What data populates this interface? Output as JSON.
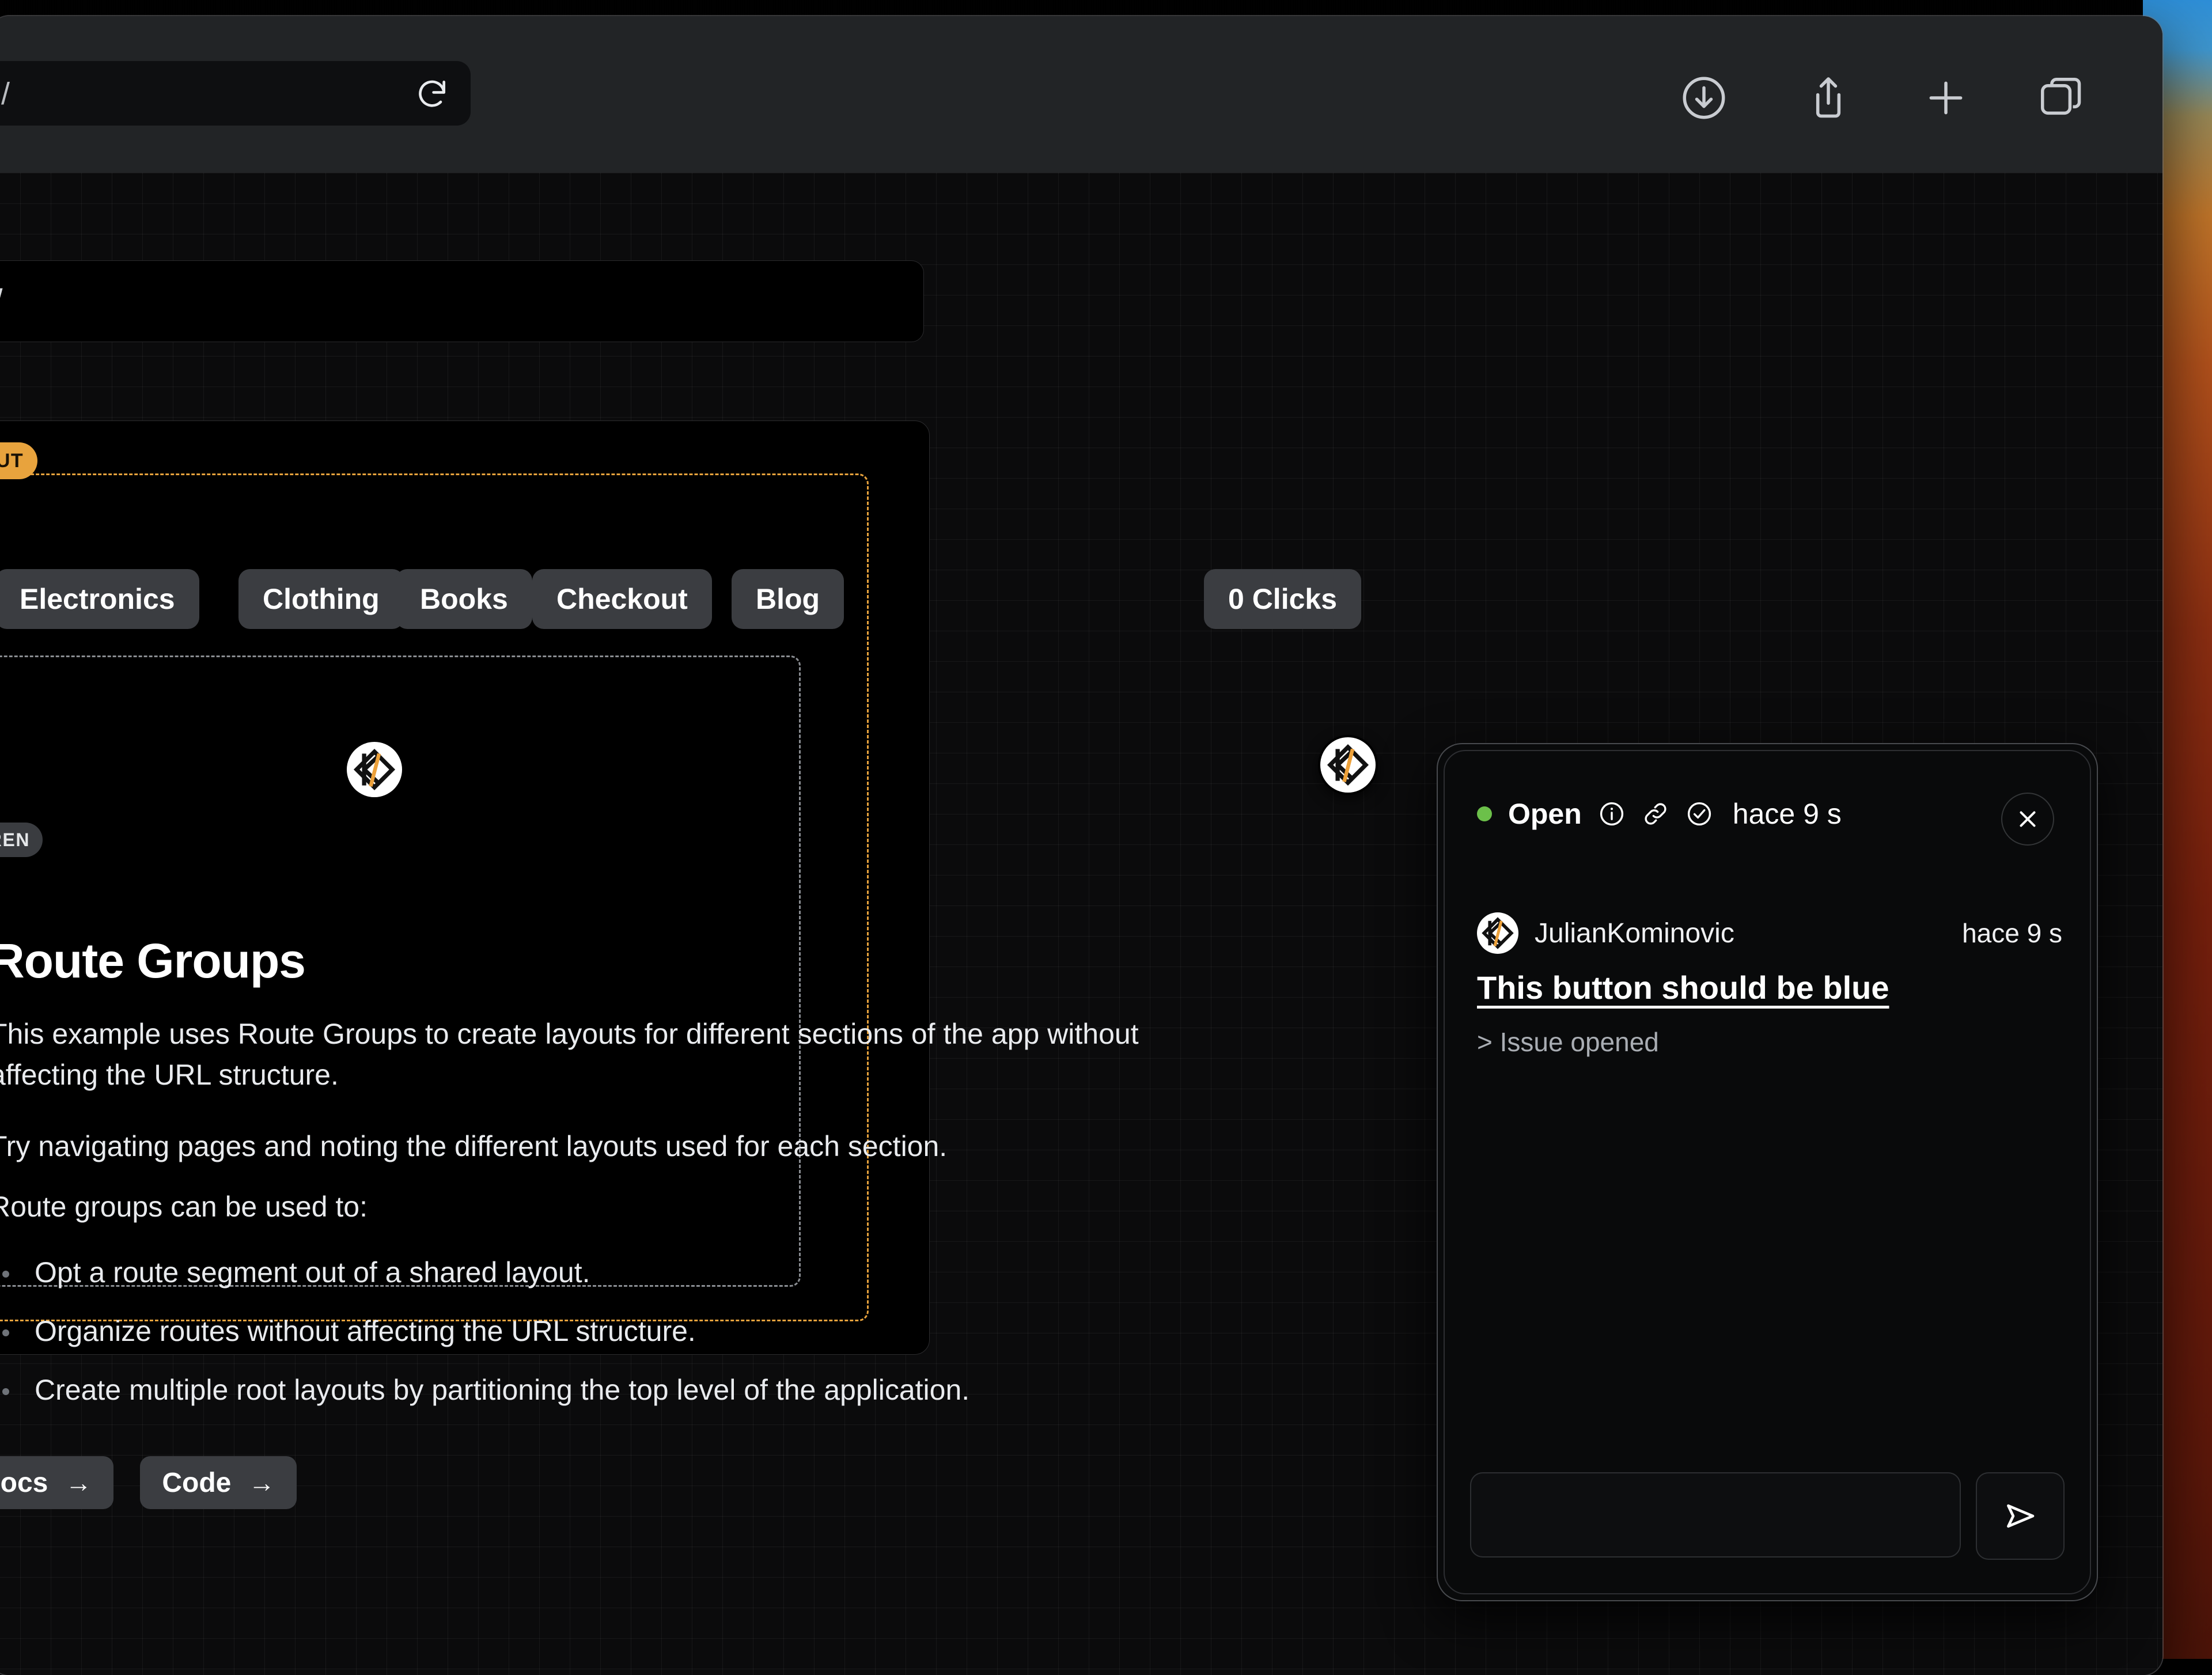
{
  "browser": {
    "address_value": "/",
    "reload_icon": "reload-icon",
    "toolbar_icons": [
      {
        "name": "download-icon",
        "label": "Downloads"
      },
      {
        "name": "share-icon",
        "label": "Share"
      },
      {
        "name": "plus-icon",
        "label": "New Tab"
      },
      {
        "name": "tabs-icon",
        "label": "Tab Overview"
      }
    ]
  },
  "page": {
    "route_value": "/",
    "devtools": {
      "layout_badge": "LAYOUT",
      "children_badge": "CHILDREN",
      "layout_color": "#e8a33d",
      "children_color": "#8a8d92"
    },
    "nav": {
      "items": [
        {
          "label": "Electronics"
        },
        {
          "label": "Clothing"
        },
        {
          "label": "Books"
        },
        {
          "label": "Checkout"
        },
        {
          "label": "Blog"
        }
      ],
      "clicks_label": "0 Clicks"
    },
    "content": {
      "title": "Route Groups",
      "para1": "This example uses Route Groups to create layouts for different sections of the app without affecting the URL structure.",
      "para2": "Try navigating pages and noting the different layouts used for each section.",
      "para3": "Route groups can be used to:",
      "bullets": [
        "Opt a route segment out of a shared layout.",
        "Organize routes without affecting the URL structure.",
        "Create multiple root layouts by partitioning the top level of the application."
      ],
      "cta": [
        {
          "label": "Docs",
          "arrow": "→"
        },
        {
          "label": "Code",
          "arrow": "→"
        }
      ]
    },
    "presence_markers": [
      {
        "name": "presence-marker-a",
        "icon": "kominovic-logo-icon"
      },
      {
        "name": "presence-marker-b",
        "icon": "kominovic-logo-icon"
      }
    ]
  },
  "issue_panel": {
    "status": "Open",
    "status_color": "#6cc04a",
    "header_icons": [
      {
        "name": "info-circle-icon"
      },
      {
        "name": "link-icon"
      },
      {
        "name": "check-circle-icon"
      }
    ],
    "header_time": "hace 9 s",
    "close_icon": "close-icon",
    "message": {
      "author": "JulianKominovic",
      "avatar_icon": "kominovic-logo-icon",
      "time": "hace 9 s",
      "title": "This button should be blue",
      "body": "> Issue opened"
    },
    "composer": {
      "value": "",
      "placeholder": "",
      "send_icon": "send-icon"
    }
  }
}
